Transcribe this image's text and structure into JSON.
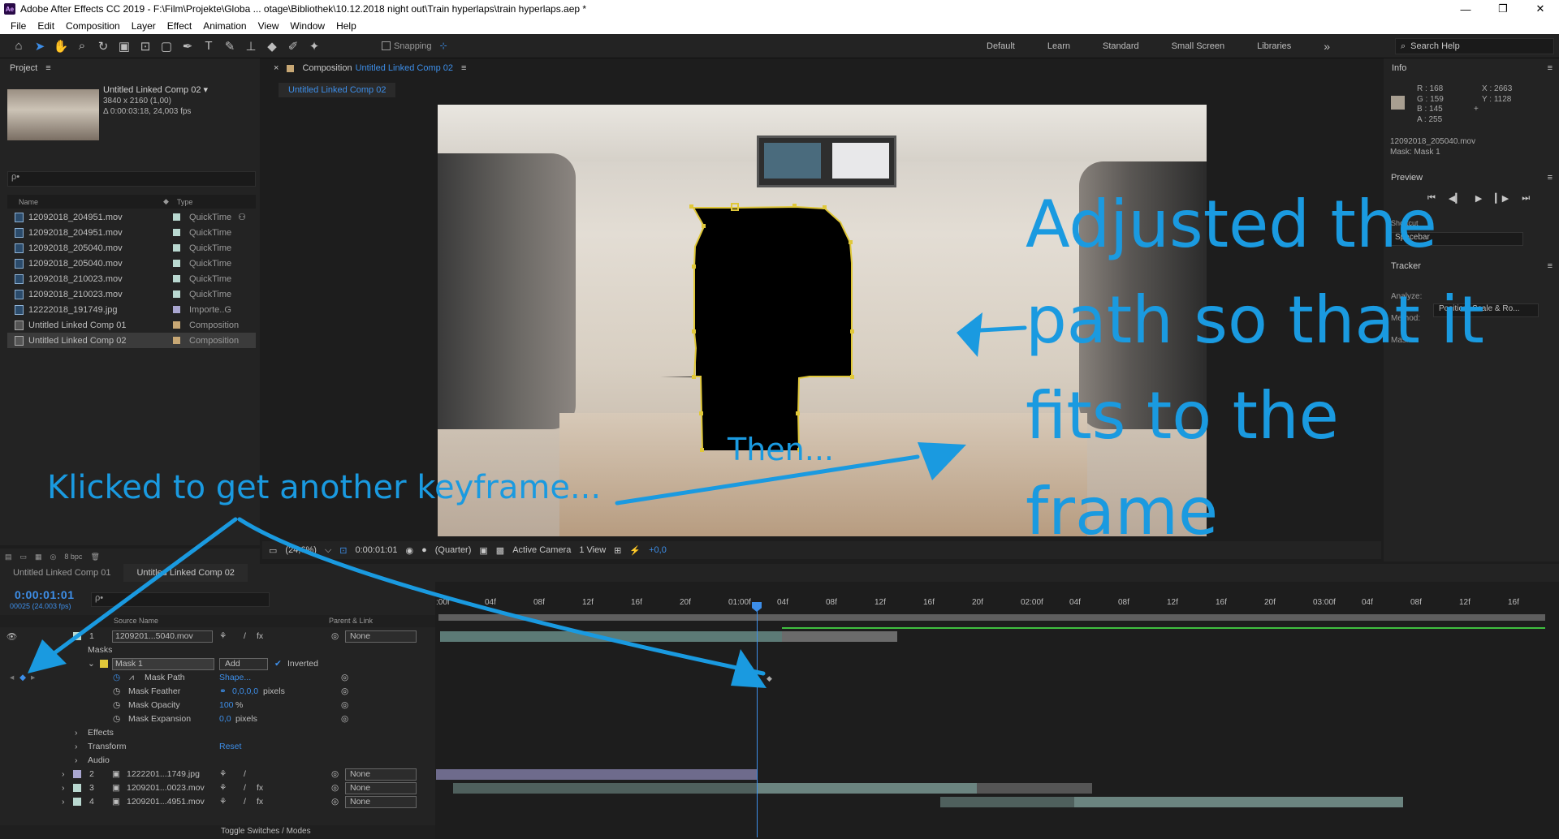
{
  "window": {
    "title": "Adobe After Effects CC 2019 - F:\\Film\\Projekte\\Globa ... otage\\Bibliothek\\10.12.2018 night out\\Train hyperlaps\\train hyperlaps.aep *",
    "app_badge": "Ae",
    "controls": {
      "minimize": "—",
      "maximize": "❐",
      "close": "✕"
    }
  },
  "menu": [
    "File",
    "Edit",
    "Composition",
    "Layer",
    "Effect",
    "Animation",
    "View",
    "Window",
    "Help"
  ],
  "toolbar": {
    "snapping_label": "Snapping",
    "workspaces": [
      "Default",
      "Learn",
      "Standard",
      "Small Screen",
      "Libraries"
    ],
    "more": "»",
    "search_placeholder": "Search Help"
  },
  "project": {
    "title": "Project",
    "selected": {
      "name": "Untitled Linked Comp 02",
      "size": "3840 x 2160 (1,00)",
      "duration": "Δ 0:00:03:18, 24,003 fps"
    },
    "search_placeholder": "ρ•",
    "columns": {
      "name": "Name",
      "type": "Type"
    },
    "items": [
      {
        "name": "12092018_204951.mov",
        "type": "QuickTime",
        "color": "#b9d8d0"
      },
      {
        "name": "12092018_204951.mov",
        "type": "QuickTime",
        "color": "#b9d8d0"
      },
      {
        "name": "12092018_205040.mov",
        "type": "QuickTime",
        "color": "#b9d8d0"
      },
      {
        "name": "12092018_205040.mov",
        "type": "QuickTime",
        "color": "#b9d8d0"
      },
      {
        "name": "12092018_210023.mov",
        "type": "QuickTime",
        "color": "#b9d8d0"
      },
      {
        "name": "12092018_210023.mov",
        "type": "QuickTime",
        "color": "#b9d8d0"
      },
      {
        "name": "12222018_191749.jpg",
        "type": "Importe..G",
        "color": "#a9a6d0"
      },
      {
        "name": "Untitled Linked Comp 01",
        "type": "Composition",
        "color": "#c7a774"
      },
      {
        "name": "Untitled Linked Comp 02",
        "type": "Composition",
        "color": "#c7a774"
      }
    ],
    "bpc": "8 bpc"
  },
  "composition": {
    "header_prefix": "Composition",
    "header_name": "Untitled Linked Comp 02",
    "tab": "Untitled Linked Comp 02",
    "viewer_bar": {
      "zoom": "(24,6%)",
      "timecode": "0:00:01:01",
      "resolution": "(Quarter)",
      "camera": "Active Camera",
      "view": "1 View",
      "exposure": "+0,0"
    }
  },
  "info": {
    "title": "Info",
    "rgba": [
      "R : 168",
      "G : 159",
      "B : 145",
      "A : 255"
    ],
    "xy": [
      "X : 2663",
      "Y : 1128"
    ],
    "swatch": "#a89f91",
    "file": "12092018_205040.mov",
    "mask": "Mask: Mask 1"
  },
  "preview": {
    "title": "Preview",
    "shortcut_label": "Shortcut",
    "shortcut": "Spacebar"
  },
  "tracker": {
    "title": "Tracker",
    "analyze": "Analyze:",
    "method": "Method:",
    "method_value": "Position, Scale & Ro...",
    "masks": "Masks:",
    "mask_value": "Mask 1"
  },
  "timeline": {
    "tabs": [
      "Untitled Linked Comp 01",
      "Untitled Linked Comp 02"
    ],
    "timecode": "0:00:01:01",
    "fps": "00025 (24.003 fps)",
    "search_placeholder": "ρ•",
    "col_source": "Source Name",
    "col_parent": "Parent & Link",
    "ruler": [
      ":00f",
      "04f",
      "08f",
      "12f",
      "16f",
      "20f",
      "01:00f",
      "04f",
      "08f",
      "12f",
      "16f",
      "20f",
      "02:00f",
      "04f",
      "08f",
      "12f",
      "16f",
      "20f",
      "03:00f",
      "04f",
      "08f",
      "12f",
      "16f"
    ],
    "layer1": {
      "num": "1",
      "name": "1209201...5040.mov",
      "parent": "None"
    },
    "masks_label": "Masks",
    "mask1": {
      "name": "Mask 1",
      "mode": "Add",
      "inverted": "Inverted"
    },
    "props": [
      {
        "name": "Mask Path",
        "value": "Shape...",
        "unit": ""
      },
      {
        "name": "Mask Feather",
        "value": "0,0,0,0",
        "unit": "pixels"
      },
      {
        "name": "Mask Opacity",
        "value": "100",
        "unit": "%"
      },
      {
        "name": "Mask Expansion",
        "value": "0,0",
        "unit": "pixels"
      }
    ],
    "groups": [
      {
        "name": "Effects",
        "value": ""
      },
      {
        "name": "Transform",
        "value": "Reset"
      },
      {
        "name": "Audio",
        "value": ""
      }
    ],
    "layers": [
      {
        "num": "2",
        "name": "1222201...1749.jpg",
        "parent": "None",
        "color": "#a9a6d0"
      },
      {
        "num": "3",
        "name": "1209201...0023.mov",
        "parent": "None",
        "color": "#b9d8d0"
      },
      {
        "num": "4",
        "name": "1209201...4951.mov",
        "parent": "None",
        "color": "#b9d8d0"
      }
    ],
    "toggle": "Toggle Switches / Modes"
  },
  "annotations": {
    "big": [
      "Adjusted the",
      "path so that it",
      "fits to the",
      "frame"
    ],
    "then": "Then...",
    "klicked": "Klicked to get another keyframe..."
  }
}
